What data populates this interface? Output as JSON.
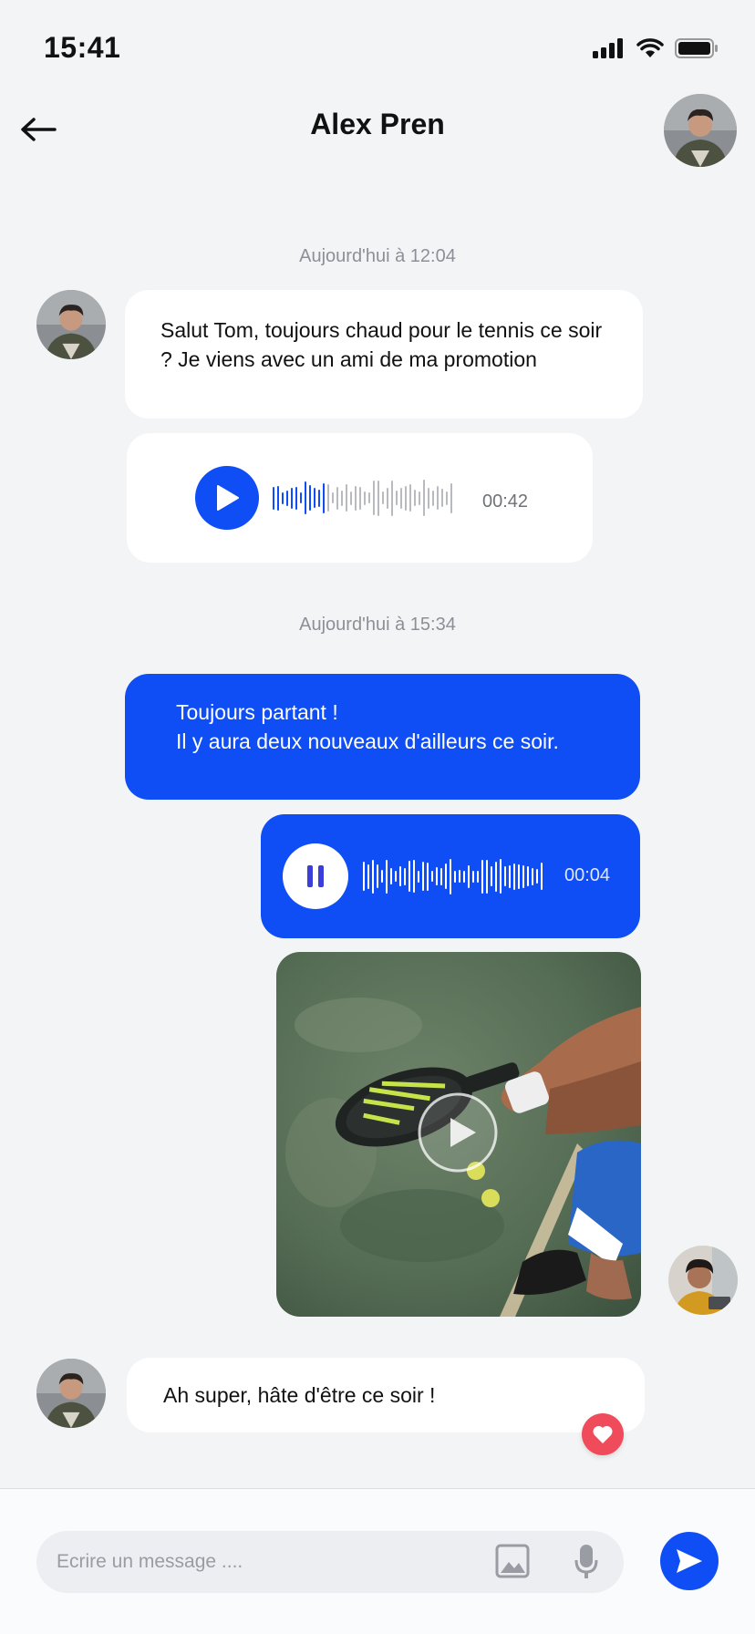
{
  "status_bar": {
    "time": "15:41"
  },
  "header": {
    "title": "Alex Pren"
  },
  "timestamps": [
    "Aujourd'hui à 12:04",
    "Aujourd'hui à 15:34"
  ],
  "messages": {
    "m1": {
      "text": "Salut Tom, toujours chaud pour le tennis ce soir ? Je viens avec un ami de ma promotion"
    },
    "m2": {
      "duration": "00:42",
      "progress": 0.3
    },
    "m3": {
      "line1": "Toujours partant !",
      "line2": "Il y aura deux nouveaux d'ailleurs ce soir."
    },
    "m4": {
      "duration": "00:04"
    },
    "m6": {
      "text": "Ah super, hâte d'être ce soir !"
    }
  },
  "composer": {
    "placeholder": "Ecrire un message ...."
  },
  "colors": {
    "accent": "#0f4df5",
    "like": "#f04b5b",
    "background": "#f3f4f6"
  },
  "icons": {
    "back": "arrow-left-icon",
    "play": "play-icon",
    "pause": "pause-icon",
    "image": "image-icon",
    "mic": "microphone-icon",
    "send": "send-icon",
    "heart": "heart-icon",
    "signal": "signal-icon",
    "wifi": "wifi-icon",
    "battery": "battery-icon"
  }
}
